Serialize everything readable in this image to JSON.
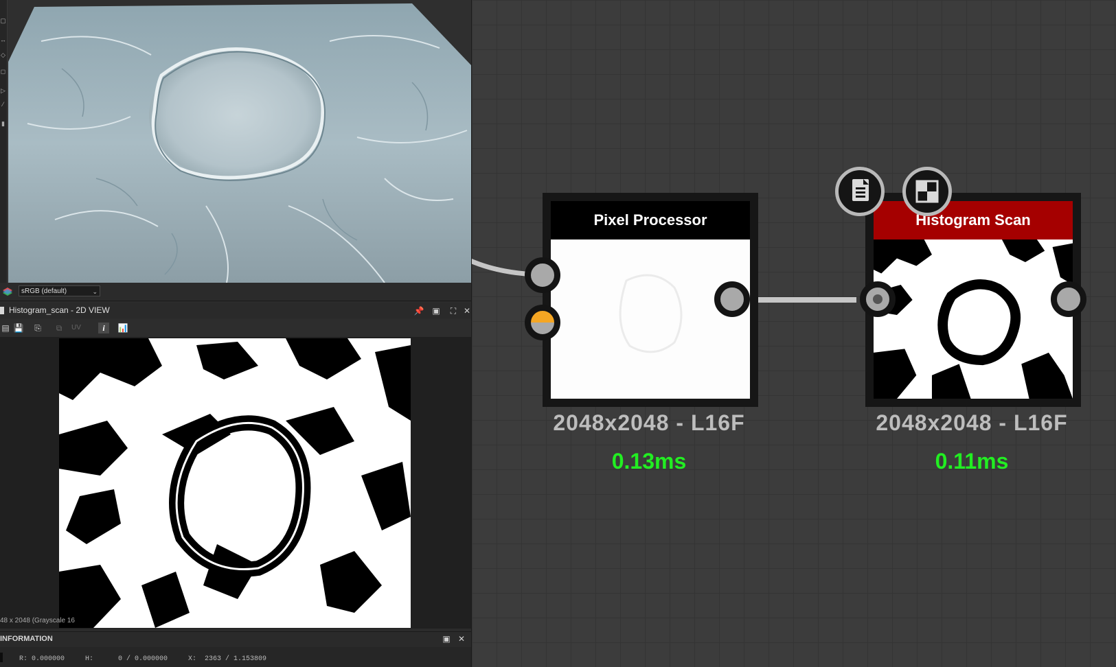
{
  "viewport_3d": {
    "toolbar_icons": [
      "camera-icon",
      "move-icon",
      "cube-icon",
      "transform-icon",
      "play-icon",
      "brush-icon",
      "histogram-icon"
    ]
  },
  "color_bar": {
    "colorspace_value": "sRGB (default)"
  },
  "panel_2d": {
    "title": "Histogram_scan - 2D VIEW",
    "uv_label": "UV",
    "info_button_label": "i",
    "resolution_text": "48 x 2048 (Grayscale 16"
  },
  "information_panel": {
    "title": "INFORMATION",
    "r_value": "R: 0.000000",
    "h_value": "H:      0 / 0.000000",
    "x_value": "X:  2363 / 1.153809"
  },
  "graph": {
    "nodes": [
      {
        "title": "Pixel Processor",
        "resolution": "2048x2048 - L16F",
        "time": "0.13ms",
        "header_color": "#000000"
      },
      {
        "title": "Histogram Scan",
        "resolution": "2048x2048 - L16F",
        "time": "0.11ms",
        "header_color": "#a50000"
      }
    ],
    "input_port_color": "#f5a623",
    "floating_buttons": [
      "document-icon",
      "checker-icon"
    ]
  }
}
